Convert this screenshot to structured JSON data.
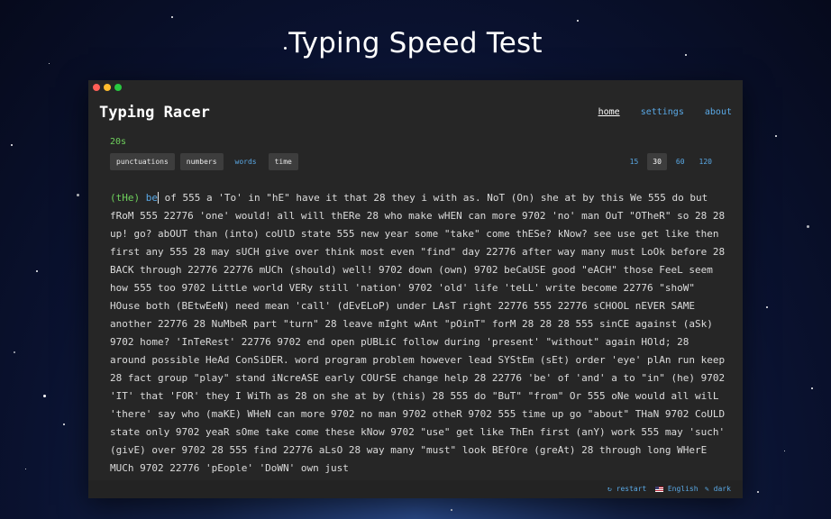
{
  "page_heading": "Typing Speed Test",
  "app": {
    "title": "Typing Racer",
    "nav": [
      "home",
      "settings",
      "about"
    ]
  },
  "timer": "20s",
  "options": {
    "punctuations": "punctuations",
    "numbers": "numbers",
    "words": "words",
    "time": "time",
    "durations": [
      "15",
      "30",
      "60",
      "120"
    ],
    "selected_duration": "30"
  },
  "typing": {
    "typed": "(tHe)",
    "current": "be",
    "remaining": " of 555 a 'To' in \"hE\" have it that 28 they i with as. NoT (On) she at by this We 555 do but fRoM 555 22776 'one' would! all will thERe 28 who make wHEN can more 9702 'no' man OuT \"OTheR\" so 28 28 up! go? abOUT than (into) coUlD state 555 new year some \"take\" come thESe? kNow? see use get like then first any 555 28 may sUCH give over think most even \"find\" day 22776 after way many must LoOk before 28 BACK through 22776 22776 mUCh (should) well! 9702 down (own) 9702 beCaUSE good \"eACH\" those FeeL seem how 555 too 9702 LittLe world VERy still 'nation' 9702 'old' life 'teLL' write become 22776 \"shoW\" HOuse both (BEtwEeN) need mean 'call' (dEvELoP) under LAsT right 22776 555 22776 sCHOOL nEVER SAME another 22776 28 NuMbeR part \"turn\" 28 leave mIght wAnt \"pOinT\" forM 28 28 28 555 sinCE against (aSk) 9702 home? 'InTeRest' 22776 9702 end open pUBLiC follow during 'present' \"without\" again HOld; 28 around possible HeAd ConSiDER. word program problem however lead SYStEm (sEt) order 'eye' plAn run keep 28 fact group \"play\" stand iNcreASE early COUrSE change help 28 22776 'be' of 'and' a to \"in\" (he) 9702 'IT' that 'FOR' they I WiTh as 28 on she at by (this) 28 555 do \"BuT\" \"from\" Or 555 oNe would all wilL 'there' say who (maKE) WHeN can more 9702 no man 9702 otheR 9702 555 time up go \"about\" THaN 9702 CoULD state only 9702 yeaR sOme take come these kNow 9702 \"use\" get like ThEn first (anY) work 555 may 'such' (givE) over 9702 28 555 find 22776 aLsO 28 way many \"must\" look BEfOre (greAt) 28 through long WHerE MUCh 9702 22776 'pEople' 'DoWN' own just"
  },
  "footer": {
    "restart": "restart",
    "language": "English",
    "theme": "dark",
    "restart_icon": "refresh-icon",
    "flag_icon": "us-flag-icon",
    "theme_icon": "pen-icon"
  },
  "colors": {
    "correct": "#6ecf5c",
    "link": "#5aa9e6",
    "window_bg": "#262626"
  }
}
